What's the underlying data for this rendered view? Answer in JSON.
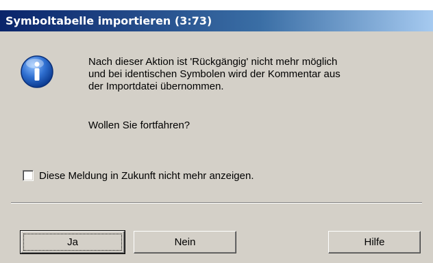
{
  "window": {
    "title": "Symboltabelle importieren (3:73)"
  },
  "icon": {
    "name": "information-icon",
    "glyph": "i",
    "color": "#1f5fbf"
  },
  "message": {
    "lines": [
      "Nach dieser Aktion ist 'Rückgängig' nicht mehr möglich",
      "und bei identischen Symbolen wird der Kommentar aus",
      "der Importdatei übernommen."
    ],
    "question": "Wollen Sie fortfahren?"
  },
  "checkbox": {
    "label": "Diese Meldung in Zukunft nicht mehr anzeigen.",
    "checked": false
  },
  "buttons": {
    "yes_label": "Ja",
    "no_label": "Nein",
    "help_label": "Hilfe"
  }
}
